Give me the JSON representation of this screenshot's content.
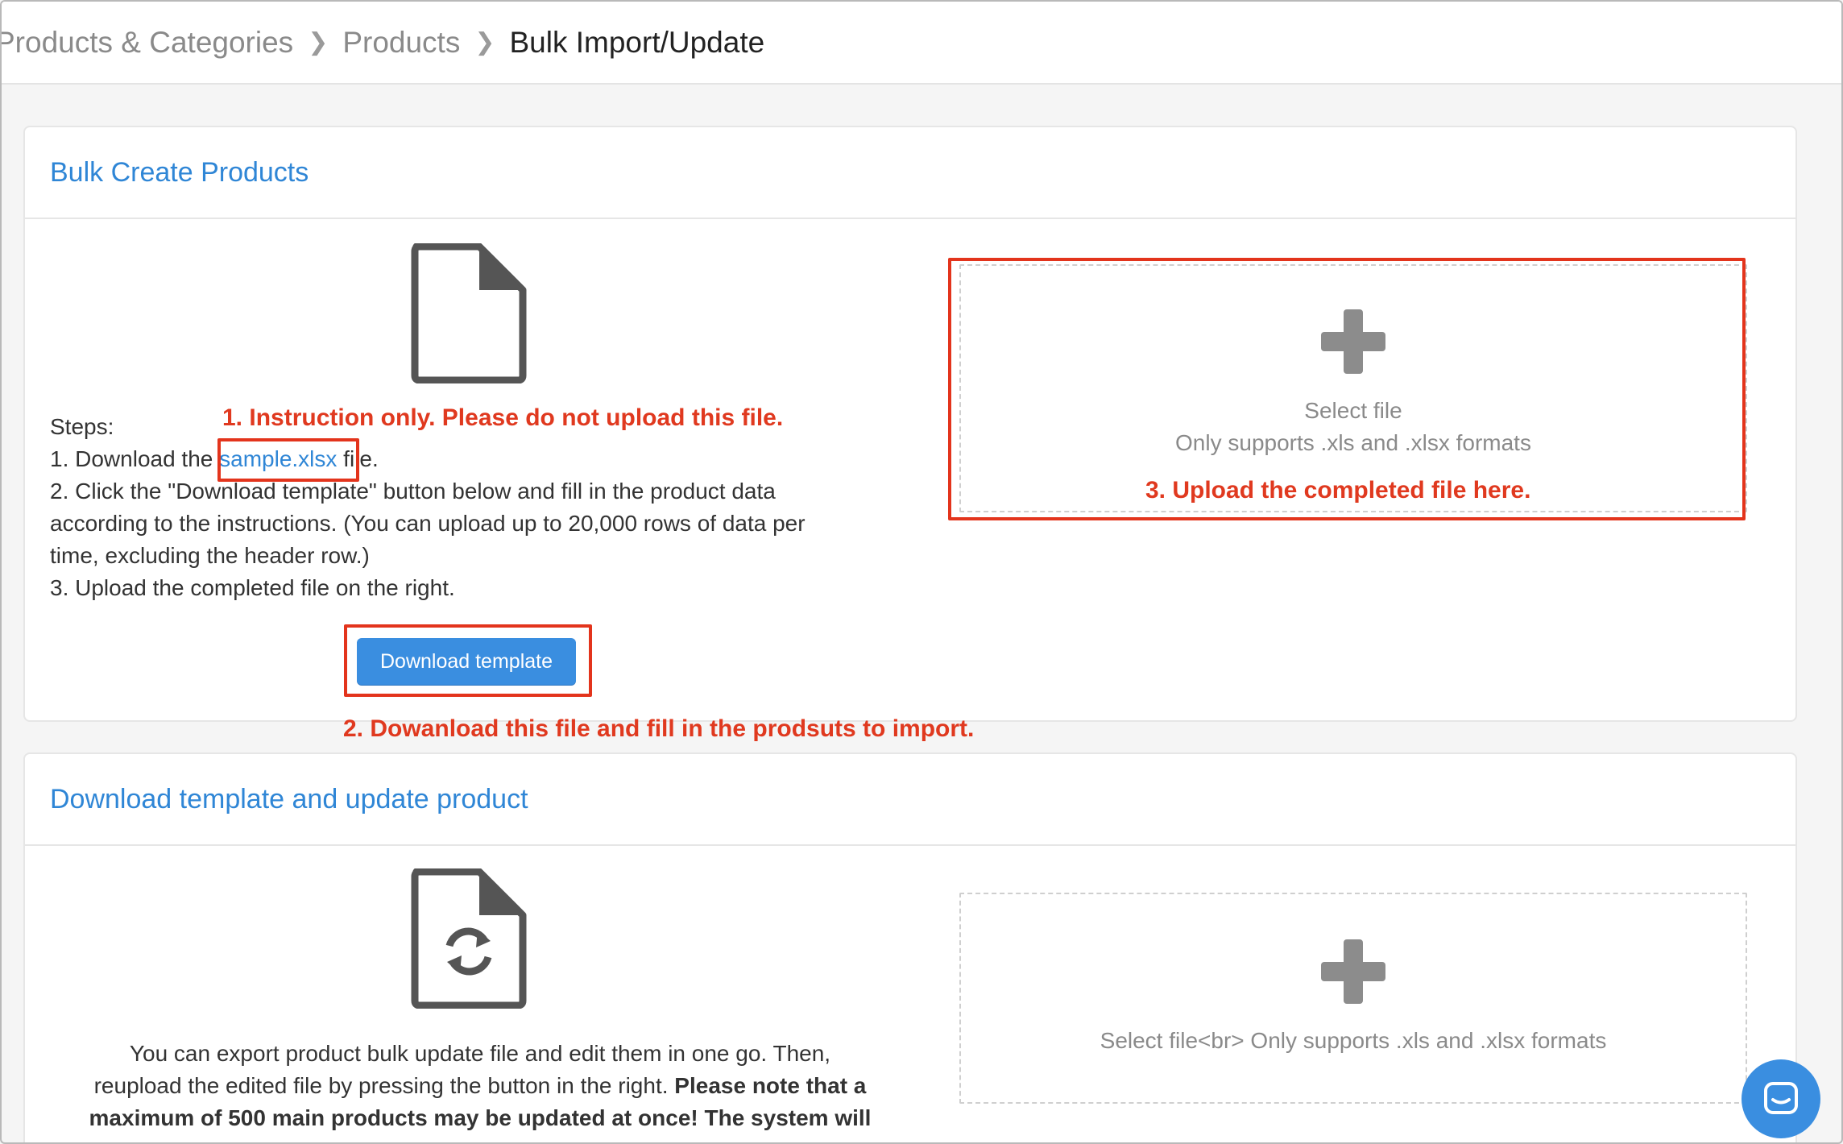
{
  "breadcrumb": {
    "items": [
      "Products & Categories",
      "Products"
    ],
    "current": "Bulk Import/Update"
  },
  "bulk_create": {
    "title": "Bulk Create Products",
    "steps_heading": "Steps:",
    "step1_prefix": "1. Download the ",
    "step1_link": "sample.xlsx",
    "step1_suffix": " file.",
    "step2_line1": "2. Click the \"Download template\" button below and fill in the product data",
    "step2_line2": "according to the instructions. (You can upload up to 20,000 rows of data per",
    "step2_line3": "time, excluding the header row.)",
    "step3": "3. Upload the completed file on the right.",
    "download_button": "Download template",
    "upload_select": "Select file",
    "upload_formats": "Only supports .xls and .xlsx formats"
  },
  "annotations": {
    "a1": "1. Instruction only. Please do not upload this file.",
    "a2": "2. Dowanload this file and fill in the prodsuts to import.",
    "a3": "3. Upload the completed file here."
  },
  "update_product": {
    "title": "Download template and update product",
    "desc_line1": "You can export product bulk update file and edit them in one go. Then,",
    "desc_line2_plain": "reupload the edited file by pressing the button in the right. ",
    "desc_line2_bold": "Please note that a",
    "desc_line3_bold": "maximum of 500 main products may be updated at once! The system will",
    "upload_text": "Select file<br> Only supports .xls and .xlsx formats"
  },
  "icons": {
    "file": "file-icon",
    "file_refresh": "file-refresh-icon",
    "plus": "plus-icon",
    "chat": "chat-icon"
  },
  "colors": {
    "accent": "#2f86d6",
    "button": "#3a8ee0",
    "annotation": "#e0391f"
  }
}
